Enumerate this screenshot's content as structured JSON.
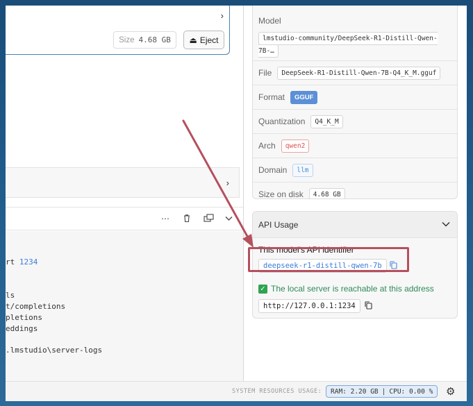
{
  "model_card": {
    "size_label": "Size",
    "size_value": "4.68 GB",
    "eject_label": "Eject"
  },
  "log": {
    "toolbar": {
      "more_icon": "⋯",
      "delete_icon": "🗑",
      "popout_icon": "⧉",
      "collapse_icon": "⌄"
    },
    "lines": [
      {
        "prefix": "rt ",
        "port": "1234"
      },
      {
        "prefix": "ls",
        "port": ""
      },
      {
        "prefix": "t/completions",
        "port": ""
      },
      {
        "prefix": "pletions",
        "port": ""
      },
      {
        "prefix": "eddings",
        "port": ""
      },
      {
        "prefix": ".lmstudio\\server-logs",
        "port": ""
      }
    ]
  },
  "model_info": {
    "model_label": "Model",
    "model_value": "lmstudio-community/DeepSeek-R1-Distill-Qwen-7B-…",
    "file_label": "File",
    "file_value": "DeepSeek-R1-Distill-Qwen-7B-Q4_K_M.gguf",
    "format_label": "Format",
    "format_value": "GGUF",
    "quant_label": "Quantization",
    "quant_value": "Q4_K_M",
    "arch_label": "Arch",
    "arch_value": "qwen2",
    "domain_label": "Domain",
    "domain_value": "llm",
    "size_label": "Size on disk",
    "size_value": "4.68 GB"
  },
  "api_usage": {
    "header": "API Usage",
    "identifier_title": "This model's API identifier",
    "identifier": "deepseek-r1-distill-qwen-7b",
    "reachable_text": "The local server is reachable at this address",
    "url": "http://127.0.0.1:1234"
  },
  "status_bar": {
    "label": "SYSTEM RESOURCES USAGE:",
    "ram": "RAM: 2.20 GB",
    "separator": "|",
    "cpu": "CPU: 0.00 %"
  },
  "colors": {
    "accent": "#3b7dd8",
    "annotation": "#b5505e",
    "success": "#2e8b57"
  }
}
